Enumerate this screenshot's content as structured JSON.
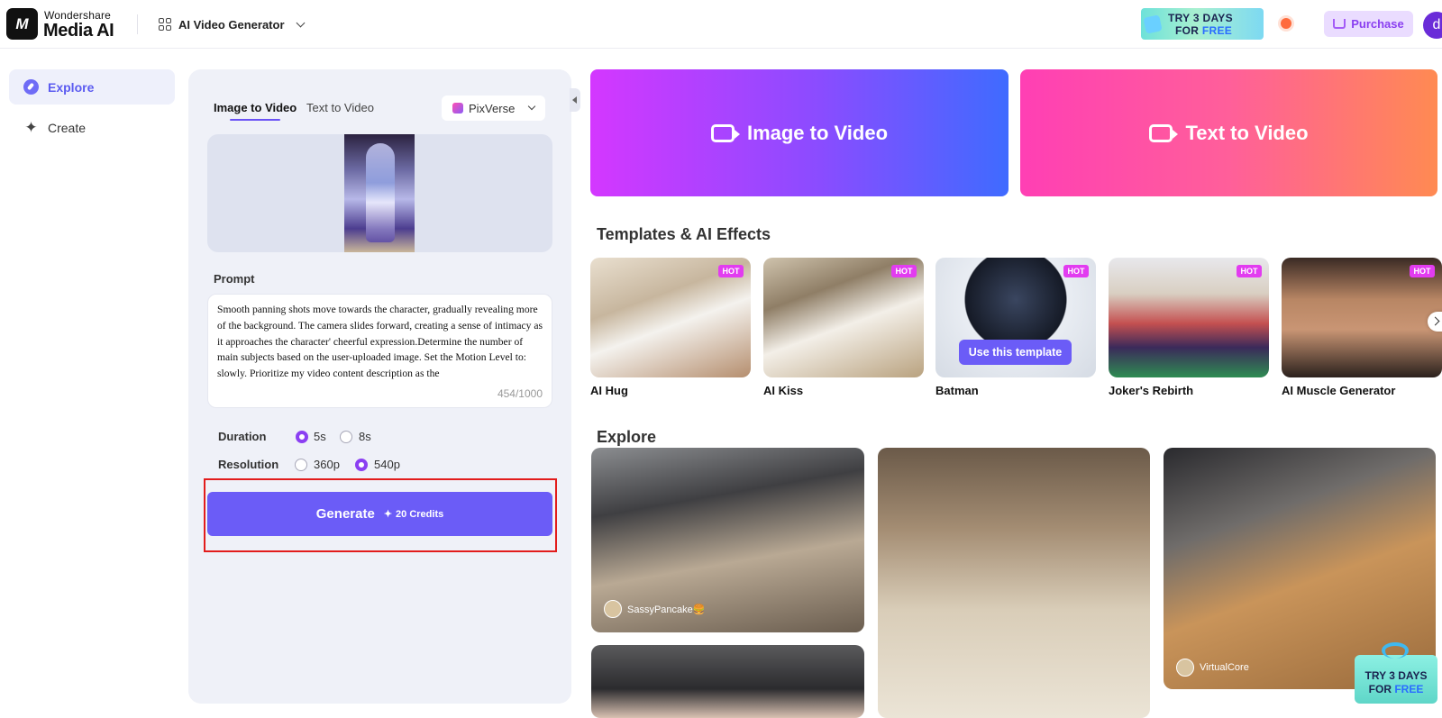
{
  "header": {
    "brand_line1": "Wondershare",
    "brand_line2": "Media AI",
    "logo_mark": "M",
    "app_switcher_label": "AI Video Generator",
    "promo_line1": "TRY 3 DAYS",
    "promo_line2_a": "FOR ",
    "promo_line2_b": "FREE",
    "purchase_label": "Purchase",
    "avatar_initial": "d"
  },
  "sidebar": {
    "items": [
      {
        "label": "Explore",
        "icon": "compass-icon",
        "active": true
      },
      {
        "label": "Create",
        "icon": "sparkle-icon",
        "active": false
      }
    ]
  },
  "generator": {
    "tabs": [
      {
        "label": "Image to Video",
        "active": true
      },
      {
        "label": "Text to Video",
        "active": false
      }
    ],
    "model": "PixVerse",
    "prompt_label": "Prompt",
    "prompt_text": "Smooth panning shots move towards the character, gradually revealing more of the background. The camera slides forward, creating a sense of intimacy as it approaches the character' cheerful expression.Determine the number of main subjects based on the user-uploaded image. Set the Motion Level to: slowly. Prioritize my video content description as the",
    "prompt_count": "454/1000",
    "duration_label": "Duration",
    "duration_options": [
      "5s",
      "8s"
    ],
    "duration_selected": "5s",
    "resolution_label": "Resolution",
    "resolution_options": [
      "360p",
      "540p"
    ],
    "resolution_selected": "540p",
    "generate_label": "Generate",
    "credits_label": "20 Credits"
  },
  "hero": {
    "image_to_video": "Image to Video",
    "text_to_video": "Text to Video"
  },
  "templates": {
    "title": "Templates & AI Effects",
    "hot_badge": "HOT",
    "use_button": "Use this template",
    "items": [
      {
        "name": "AI Hug",
        "hot": true
      },
      {
        "name": "AI Kiss",
        "hot": true
      },
      {
        "name": "Batman",
        "hot": true
      },
      {
        "name": "Joker's Rebirth",
        "hot": true
      },
      {
        "name": "AI Muscle Generator",
        "hot": true
      }
    ]
  },
  "explore": {
    "title": "Explore",
    "items": [
      {
        "user": "SassyPancake🍔"
      },
      {
        "user": ""
      },
      {
        "user": "VirtualCore"
      }
    ]
  },
  "floating_promo": {
    "line1": "TRY 3 DAYS",
    "line2_a": "FOR ",
    "line2_b": "FREE"
  },
  "colors": {
    "accent": "#6b5cf7",
    "hot_badge": "#e23cf0",
    "highlight": "#e21c1c"
  }
}
